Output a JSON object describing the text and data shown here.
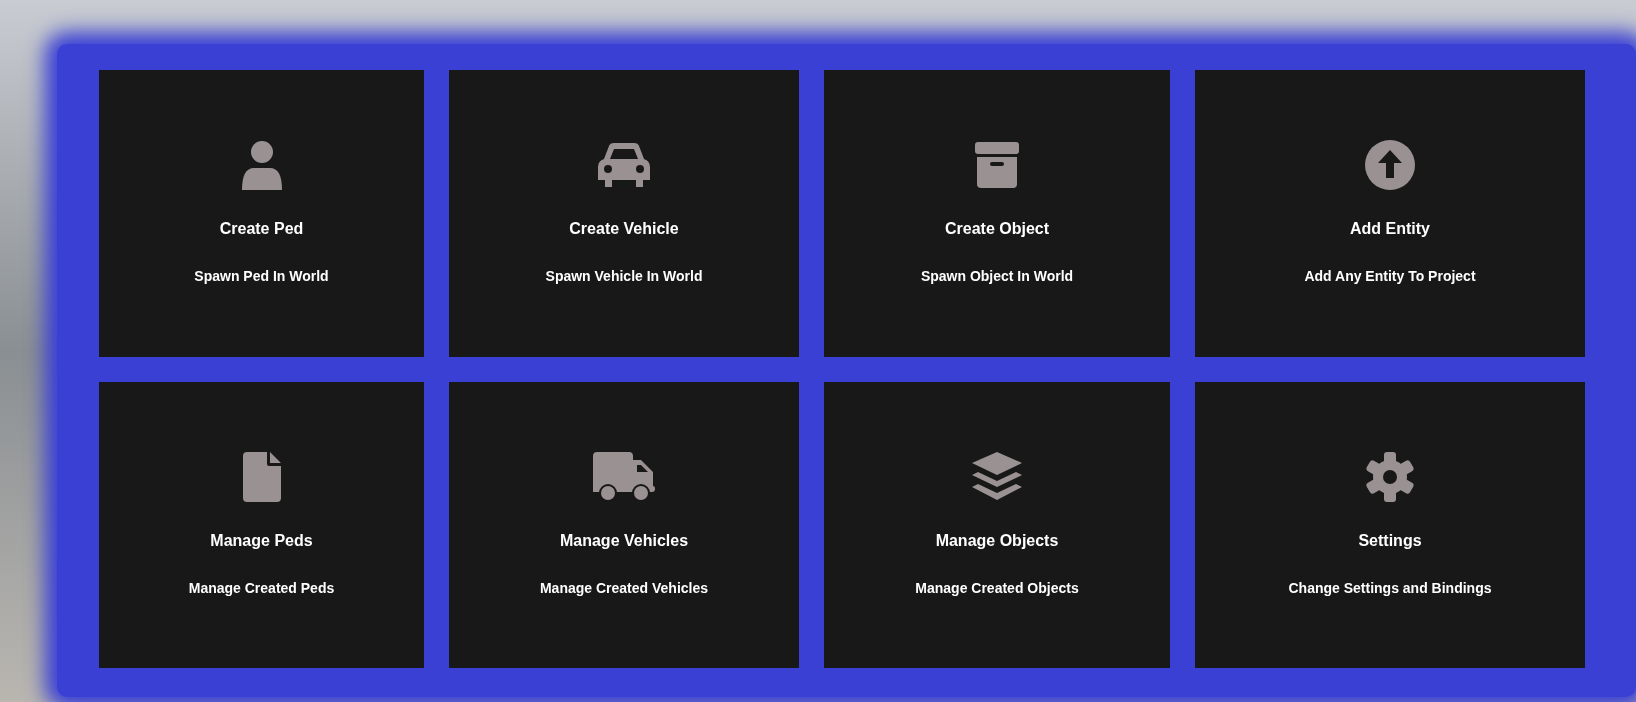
{
  "cards": [
    {
      "title": "Create Ped",
      "subtitle": "Spawn Ped In World"
    },
    {
      "title": "Create Vehicle",
      "subtitle": "Spawn Vehicle In World"
    },
    {
      "title": "Create Object",
      "subtitle": "Spawn Object In World"
    },
    {
      "title": "Add Entity",
      "subtitle": "Add Any Entity To Project"
    },
    {
      "title": "Manage Peds",
      "subtitle": "Manage Created Peds"
    },
    {
      "title": "Manage Vehicles",
      "subtitle": "Manage Created Vehicles"
    },
    {
      "title": "Manage Objects",
      "subtitle": "Manage Created Objects"
    },
    {
      "title": "Settings",
      "subtitle": "Change Settings and Bindings"
    }
  ]
}
